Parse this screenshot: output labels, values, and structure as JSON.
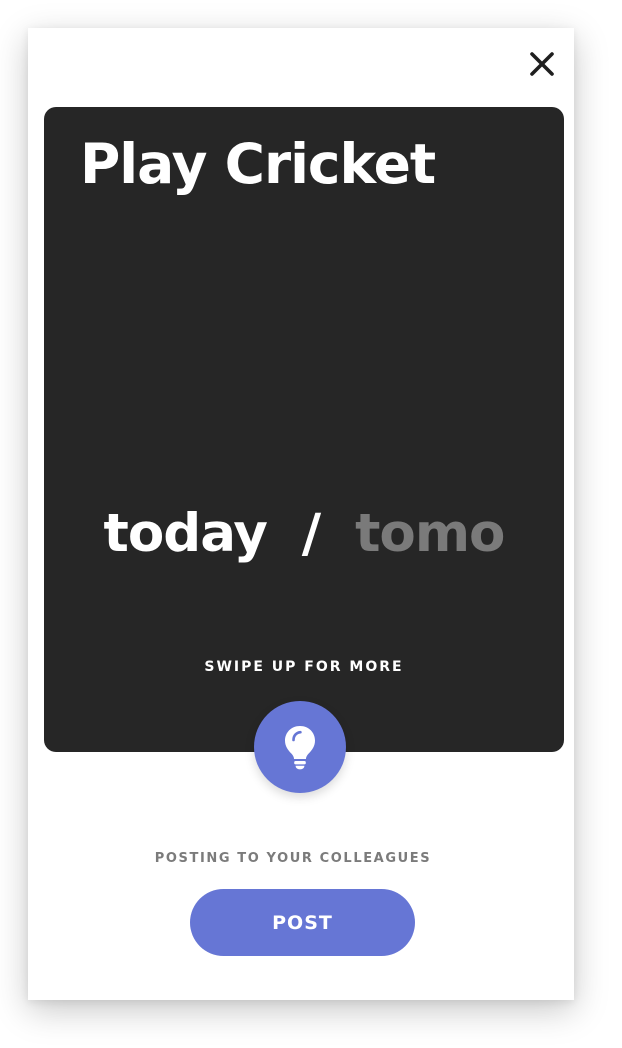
{
  "card": {
    "title": "Play Cricket",
    "when_options": [
      "today",
      "tomo"
    ],
    "when_separator": "/",
    "selected_option": "today",
    "swipe_hint": "SWIPE UP FOR MORE"
  },
  "footer": {
    "posting_label": "POSTING TO YOUR COLLEAGUES",
    "post_button": "POST"
  },
  "icons": {
    "close": "close-icon",
    "idea": "lightbulb-icon"
  },
  "colors": {
    "card_background": "#262626",
    "accent": "#6676d5",
    "inactive_option": "#7a7a7a",
    "label_gray": "#7b7b7b"
  }
}
